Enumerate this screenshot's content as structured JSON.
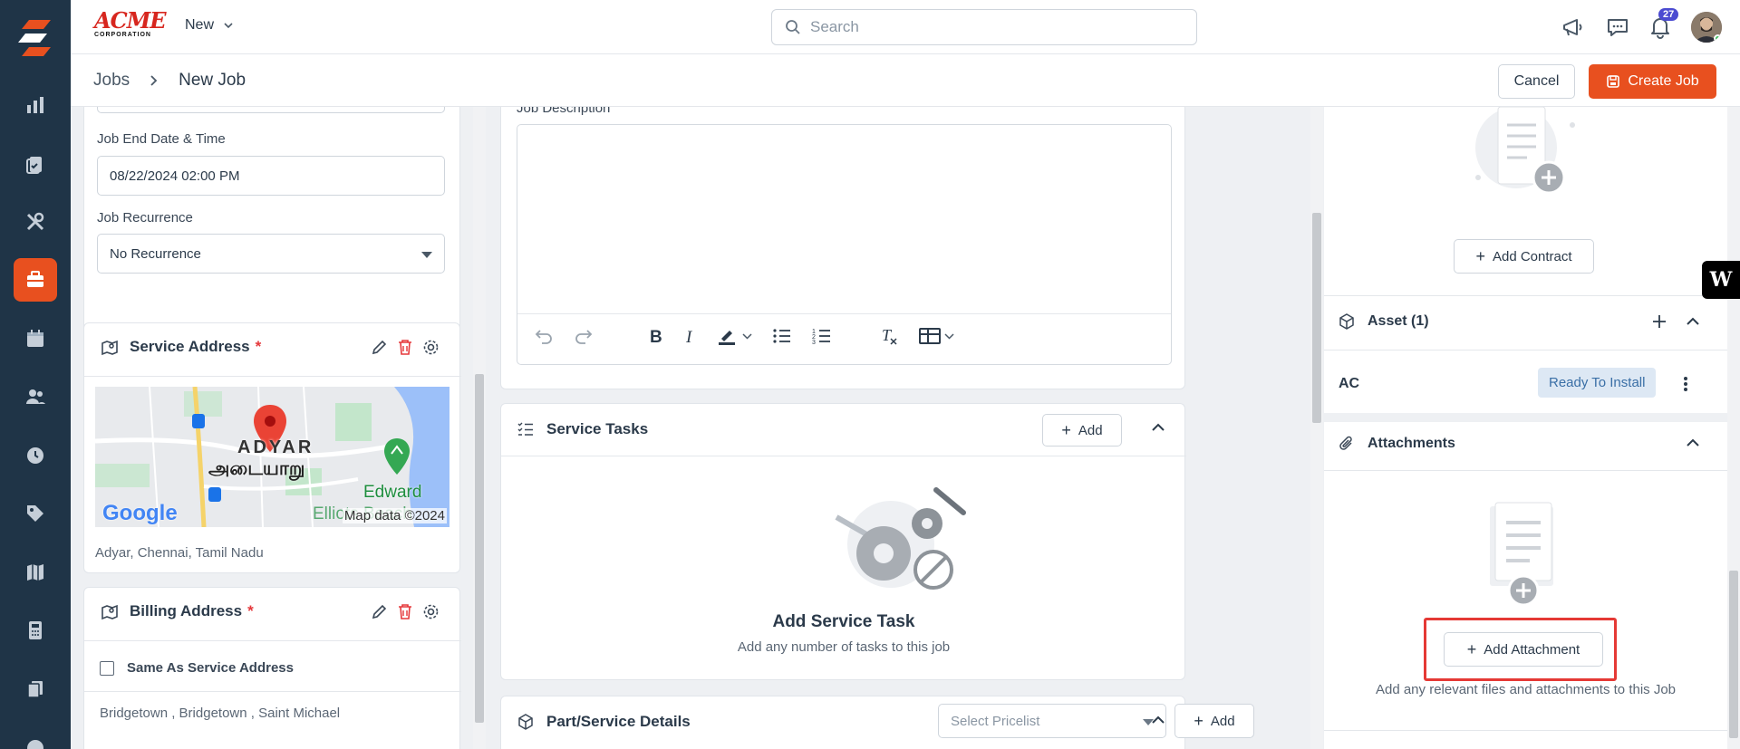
{
  "brand": {
    "name": "ACME",
    "sub": "CORPORATION"
  },
  "topbar": {
    "new_label": "New",
    "search_placeholder": "Search",
    "notifications_count": "27"
  },
  "breadcrumb": {
    "root": "Jobs",
    "current": "New Job"
  },
  "actions": {
    "cancel": "Cancel",
    "create": "Create Job"
  },
  "left_column": {
    "end_label": "Job End Date & Time",
    "end_value": "08/22/2024 02:00 PM",
    "recurrence_label": "Job Recurrence",
    "recurrence_value": "No Recurrence",
    "service_address": {
      "title": "Service Address",
      "required_mark": "*",
      "map_label_en": "ADYAR",
      "map_label_ta": "அடையாறு",
      "map_place": "Edward",
      "map_place2": "Elliots Beach",
      "map_credit": "Map data ©2024",
      "map_logo": "Google",
      "address": "Adyar, Chennai, Tamil Nadu"
    },
    "billing_address": {
      "title": "Billing Address",
      "required_mark": "*",
      "same_as_label": "Same As Service Address",
      "address": "Bridgetown , Bridgetown , Saint Michael"
    }
  },
  "middle_column": {
    "description_label": "Job Description",
    "service_tasks": {
      "title": "Service Tasks",
      "add_label": "Add",
      "empty_title": "Add Service Task",
      "empty_sub": "Add any number of tasks to this job"
    },
    "parts": {
      "title": "Part/Service Details",
      "pricelist_placeholder": "Select Pricelist",
      "add_label": "Add"
    }
  },
  "right_column": {
    "add_contract_label": "Add Contract",
    "asset": {
      "title": "Asset (1)",
      "name": "AC",
      "status": "Ready To Install"
    },
    "attachments": {
      "title": "Attachments",
      "add_label": "Add Attachment",
      "hint": "Add any relevant files and attachments to this Job"
    },
    "side_badge": "W"
  },
  "colors": {
    "accent": "#e8501f",
    "nav_bg": "#1f3447",
    "highlight": "#e53935",
    "status_pill": "#dde8f4"
  }
}
